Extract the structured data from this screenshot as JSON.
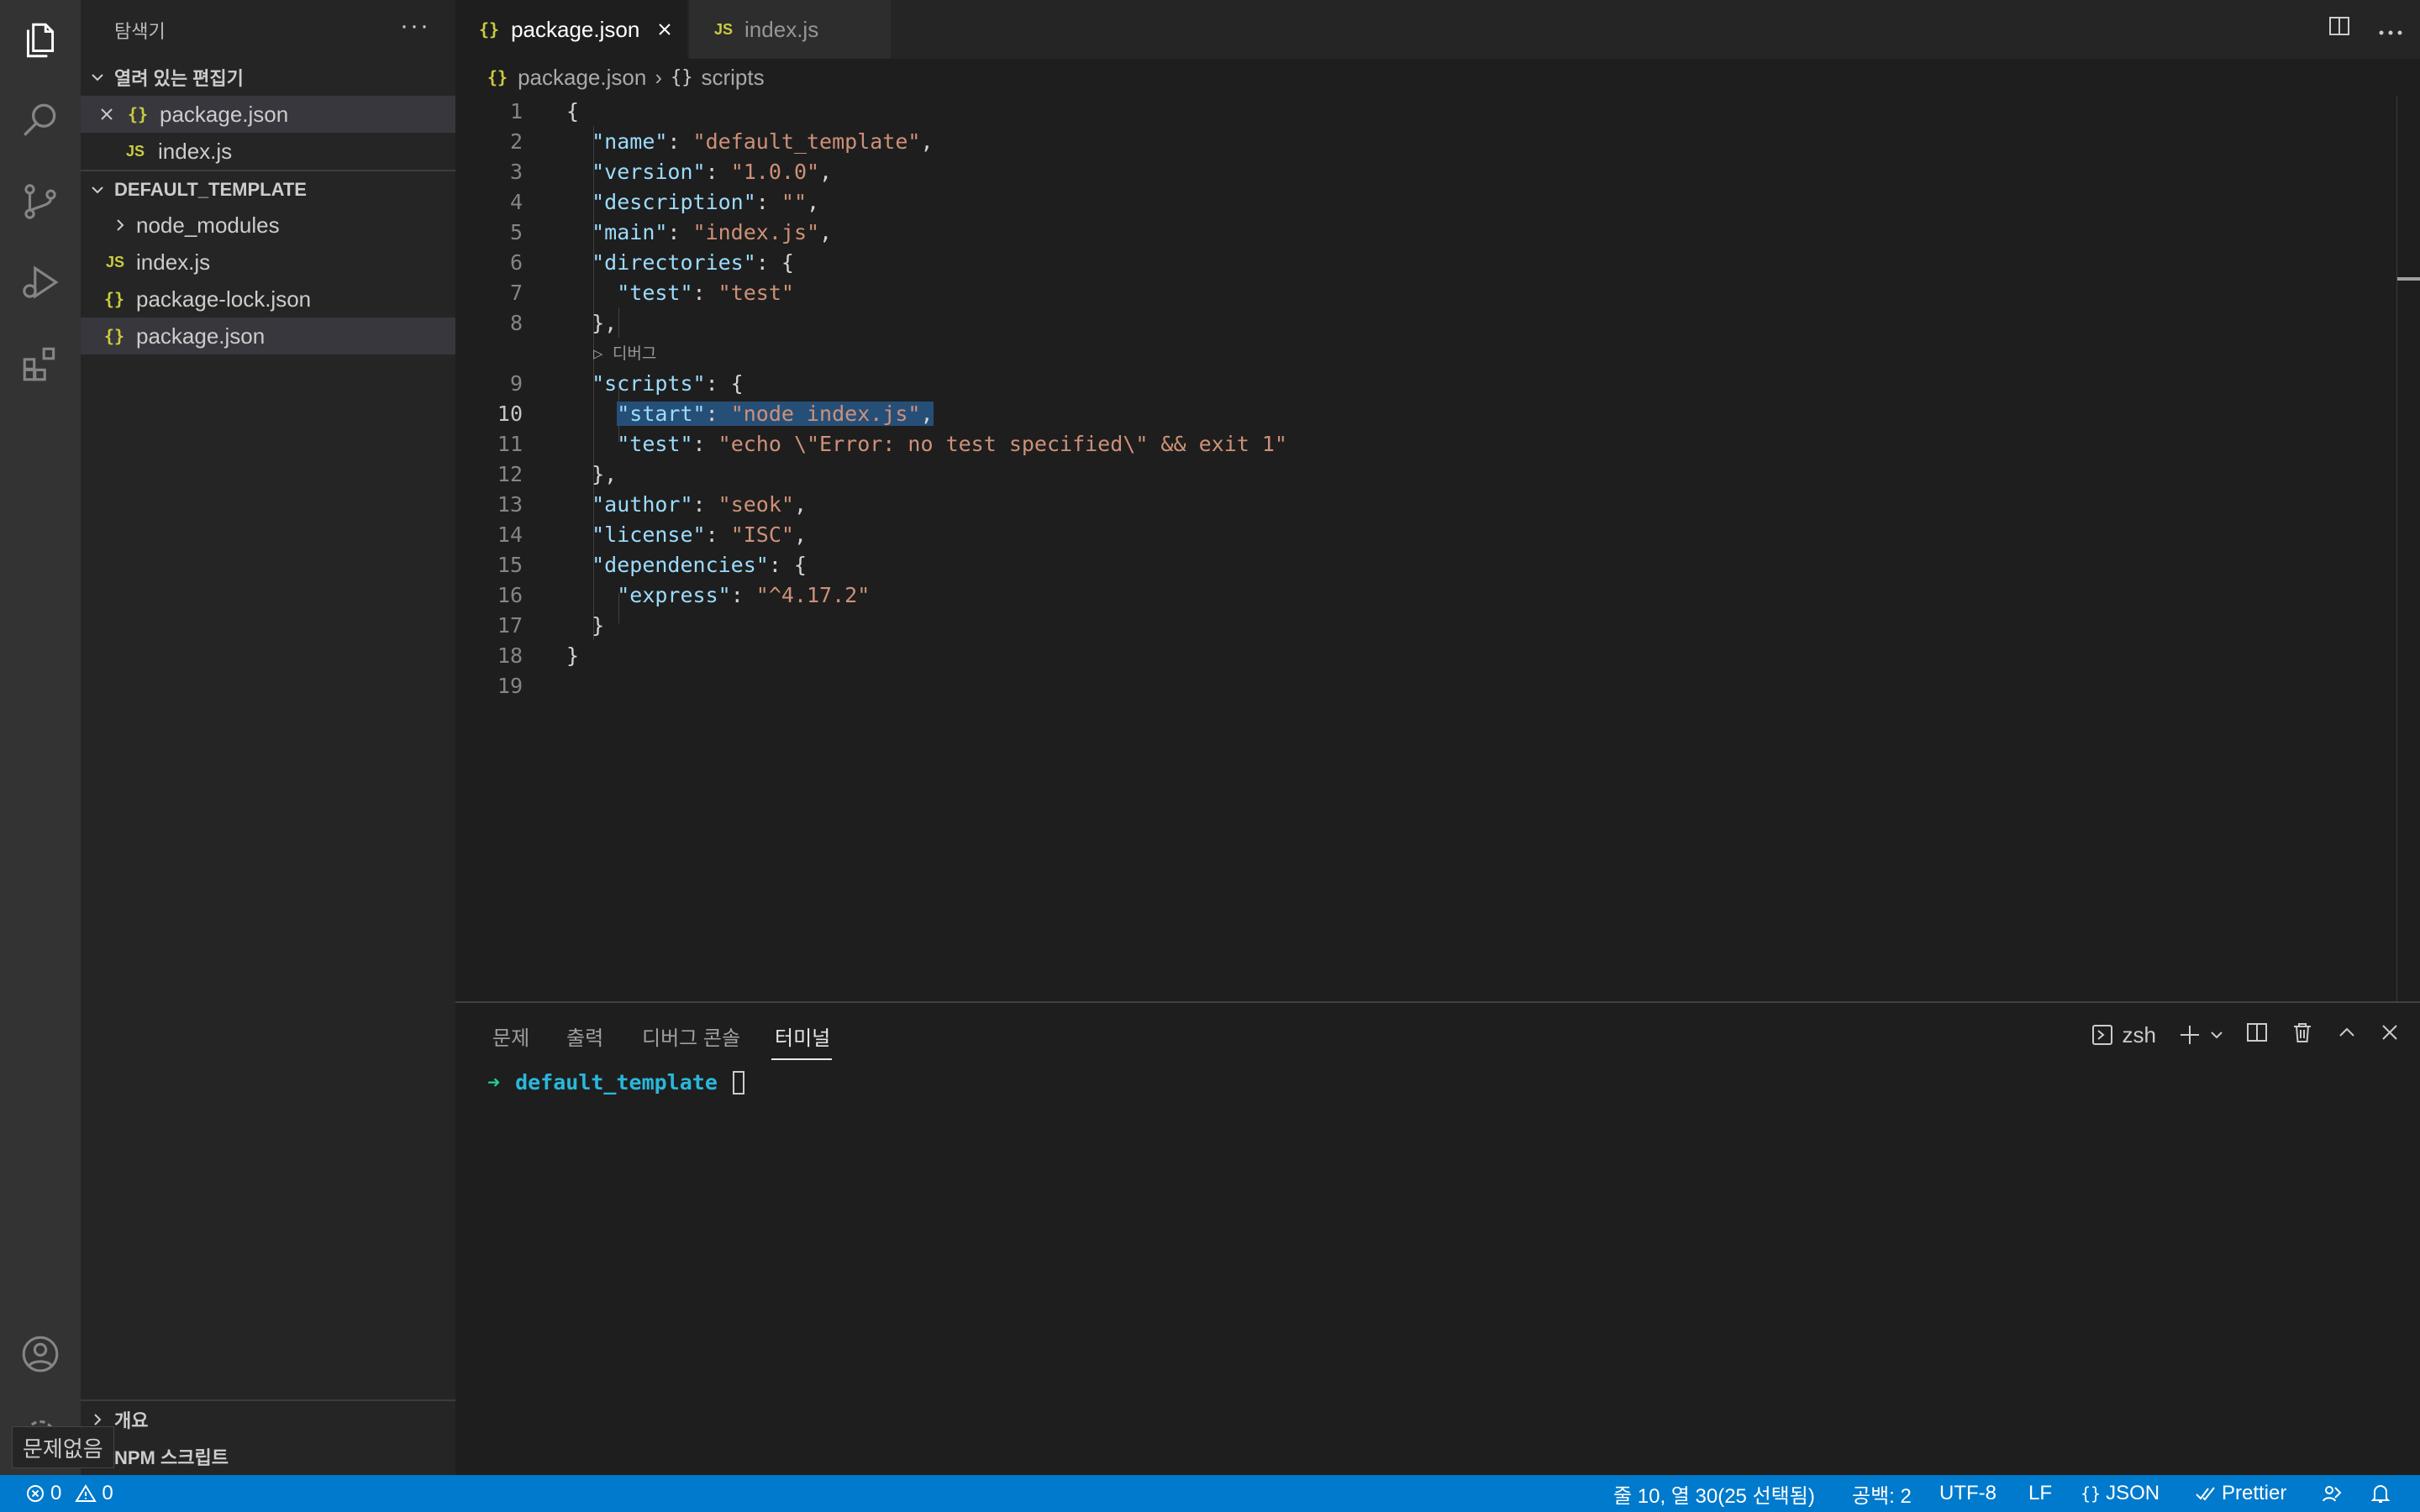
{
  "sidebar": {
    "title": "탐색기",
    "more": "···",
    "open_editors": {
      "header": "열려 있는 편집기",
      "items": [
        {
          "icon": "{}",
          "label": "package.json"
        },
        {
          "icon": "JS",
          "label": "index.js"
        }
      ]
    },
    "project": {
      "header": "DEFAULT_TEMPLATE",
      "items": [
        {
          "icon": "",
          "label": "node_modules"
        },
        {
          "icon": "JS",
          "label": "index.js"
        },
        {
          "icon": "{}",
          "label": "package-lock.json"
        },
        {
          "icon": "{}",
          "label": "package.json"
        }
      ]
    },
    "outline": "개요",
    "npm_scripts": "NPM 스크립트"
  },
  "tabs": [
    {
      "icon": "{}",
      "label": "package.json",
      "close": "×"
    },
    {
      "icon": "JS",
      "label": "index.js"
    }
  ],
  "breadcrumb": {
    "file_icon": "{}",
    "file": "package.json",
    "sep": "›",
    "symbol_icon": "{}",
    "symbol": "scripts"
  },
  "editor": {
    "codelens": "▷ 디버그",
    "lines": [
      {
        "n": "1",
        "parts": [
          [
            "p",
            "{"
          ]
        ]
      },
      {
        "n": "2",
        "parts": [
          [
            "p",
            "  "
          ],
          [
            "k",
            "\"name\""
          ],
          [
            "p",
            ": "
          ],
          [
            "s",
            "\"default_template\""
          ],
          [
            "p",
            ","
          ]
        ]
      },
      {
        "n": "3",
        "parts": [
          [
            "p",
            "  "
          ],
          [
            "k",
            "\"version\""
          ],
          [
            "p",
            ": "
          ],
          [
            "s",
            "\"1.0.0\""
          ],
          [
            "p",
            ","
          ]
        ]
      },
      {
        "n": "4",
        "parts": [
          [
            "p",
            "  "
          ],
          [
            "k",
            "\"description\""
          ],
          [
            "p",
            ": "
          ],
          [
            "s",
            "\"\""
          ],
          [
            "p",
            ","
          ]
        ]
      },
      {
        "n": "5",
        "parts": [
          [
            "p",
            "  "
          ],
          [
            "k",
            "\"main\""
          ],
          [
            "p",
            ": "
          ],
          [
            "s",
            "\"index.js\""
          ],
          [
            "p",
            ","
          ]
        ]
      },
      {
        "n": "6",
        "parts": [
          [
            "p",
            "  "
          ],
          [
            "k",
            "\"directories\""
          ],
          [
            "p",
            ": {"
          ]
        ]
      },
      {
        "n": "7",
        "parts": [
          [
            "p",
            "    "
          ],
          [
            "k",
            "\"test\""
          ],
          [
            "p",
            ": "
          ],
          [
            "s",
            "\"test\""
          ]
        ]
      },
      {
        "n": "8",
        "parts": [
          [
            "p",
            "  },"
          ]
        ]
      },
      {
        "n": "9",
        "parts": [
          [
            "p",
            "  "
          ],
          [
            "k",
            "\"scripts\""
          ],
          [
            "p",
            ": {"
          ]
        ]
      },
      {
        "n": "10",
        "parts": [
          [
            "p",
            "    "
          ],
          [
            "k",
            "\"start\""
          ],
          [
            "p",
            ": "
          ],
          [
            "s",
            "\"node index.js\""
          ],
          [
            "p",
            ","
          ]
        ]
      },
      {
        "n": "11",
        "parts": [
          [
            "p",
            "    "
          ],
          [
            "k",
            "\"test\""
          ],
          [
            "p",
            ": "
          ],
          [
            "s",
            "\"echo \\\"Error: no test specified\\\" && exit 1\""
          ]
        ]
      },
      {
        "n": "12",
        "parts": [
          [
            "p",
            "  },"
          ]
        ]
      },
      {
        "n": "13",
        "parts": [
          [
            "p",
            "  "
          ],
          [
            "k",
            "\"author\""
          ],
          [
            "p",
            ": "
          ],
          [
            "s",
            "\"seok\""
          ],
          [
            "p",
            ","
          ]
        ]
      },
      {
        "n": "14",
        "parts": [
          [
            "p",
            "  "
          ],
          [
            "k",
            "\"license\""
          ],
          [
            "p",
            ": "
          ],
          [
            "s",
            "\"ISC\""
          ],
          [
            "p",
            ","
          ]
        ]
      },
      {
        "n": "15",
        "parts": [
          [
            "p",
            "  "
          ],
          [
            "k",
            "\"dependencies\""
          ],
          [
            "p",
            ": {"
          ]
        ]
      },
      {
        "n": "16",
        "parts": [
          [
            "p",
            "    "
          ],
          [
            "k",
            "\"express\""
          ],
          [
            "p",
            ": "
          ],
          [
            "s",
            "\"^4.17.2\""
          ]
        ]
      },
      {
        "n": "17",
        "parts": [
          [
            "p",
            "  }"
          ]
        ]
      },
      {
        "n": "18",
        "parts": [
          [
            "p",
            "}"
          ]
        ]
      },
      {
        "n": "19",
        "parts": [
          [
            "p",
            ""
          ]
        ]
      }
    ],
    "current_line": "10"
  },
  "panel": {
    "tabs": [
      "문제",
      "출력",
      "디버그 콘솔",
      "터미널"
    ],
    "active_tab": "터미널",
    "shell": "zsh",
    "prompt_arrow": "➜",
    "prompt_dir": "default_template"
  },
  "tooltip": "문제없음",
  "statusbar": {
    "errors": "0",
    "warnings": "0",
    "position": "줄 10, 열 30(25 선택됨)",
    "spaces": "공백: 2",
    "encoding": "UTF-8",
    "eol": "LF",
    "lang_icon": "{}",
    "language": "JSON",
    "formatter": "Prettier"
  },
  "colors": {
    "statusbar": "#007acc",
    "activity": "#333333",
    "sidebar": "#252526",
    "editor": "#1e1e1e",
    "selection": "#264f78",
    "json_key": "#9cdcfe",
    "json_string": "#ce9178"
  }
}
